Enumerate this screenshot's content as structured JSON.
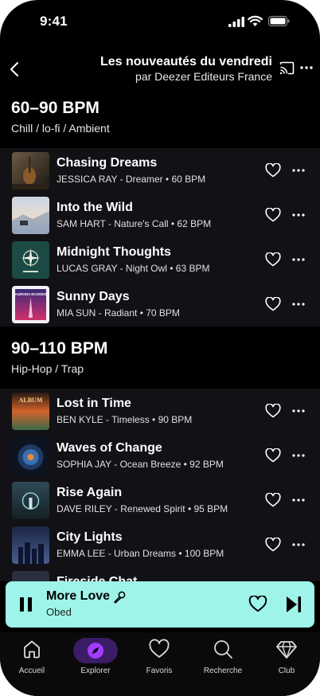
{
  "status_bar": {
    "time": "9:41"
  },
  "header": {
    "title": "Les nouveautés du vendredi",
    "subtitle": "par Deezer Editeurs France"
  },
  "sections": [
    {
      "heading": "60–90 BPM",
      "subheading": "Chill / lo-fi / Ambient",
      "tracks": [
        {
          "title": "Chasing Dreams",
          "meta": "JESSICA RAY - Dreamer • 60 BPM"
        },
        {
          "title": "Into the Wild",
          "meta": "SAM HART - Nature's Call • 62 BPM"
        },
        {
          "title": "Midnight Thoughts",
          "meta": "LUCAS GRAY - Night Owl • 63 BPM"
        },
        {
          "title": "Sunny Days",
          "meta": "MIA SUN - Radiant • 70 BPM"
        }
      ]
    },
    {
      "heading": "90–110 BPM",
      "subheading": "Hip-Hop / Trap",
      "tracks": [
        {
          "title": "Lost in Time",
          "meta": "BEN KYLE - Timeless • 90 BPM"
        },
        {
          "title": "Waves of Change",
          "meta": "SOPHIA JAY - Ocean Breeze • 92 BPM"
        },
        {
          "title": "Rise Again",
          "meta": "DAVE RILEY - Renewed Spirit • 95 BPM"
        },
        {
          "title": "City Lights",
          "meta": "EMMA LEE - Urban Dreams • 100 BPM"
        },
        {
          "title": "Fireside Chat",
          "meta": ""
        }
      ]
    }
  ],
  "cover_texts": {
    "sunny": "AURORA ECHOES",
    "album": "ALBUM"
  },
  "player": {
    "title": "More Love",
    "artist": "Obed"
  },
  "nav": [
    {
      "label": "Accueil",
      "icon": "home-icon"
    },
    {
      "label": "Explorer",
      "icon": "compass-icon"
    },
    {
      "label": "Favoris",
      "icon": "heart-icon"
    },
    {
      "label": "Recherche",
      "icon": "search-icon"
    },
    {
      "label": "Club",
      "icon": "diamond-icon"
    }
  ],
  "colors": {
    "accent": "#9ef4e8",
    "explorer": "#a23bff",
    "background": "#000000",
    "band": "#121116"
  }
}
